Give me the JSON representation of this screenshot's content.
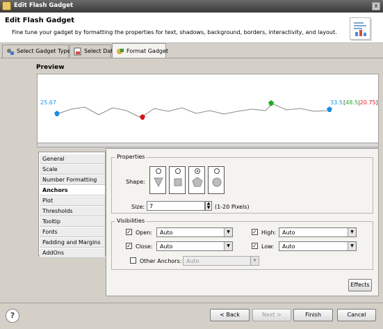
{
  "window": {
    "title": "Edit Flash Gadget",
    "close_glyph": "x"
  },
  "header": {
    "title": "Edit Flash Gadget",
    "subtitle": "Fine tune your gadget by formatting the properties for text, shadows, background, borders, interactivity, and layout."
  },
  "tabs": [
    {
      "label": "Select Gadget Type",
      "icon": "gadget-type-icon"
    },
    {
      "label": "Select Data",
      "icon": "data-icon"
    },
    {
      "label": "Format Gadget",
      "icon": "format-icon",
      "active": true
    }
  ],
  "preview": {
    "label": "Preview",
    "open_value": "25.67",
    "close_value": "33.5",
    "high_value": "48.5",
    "low_value": "20.75",
    "open_color": "#1a8fe0",
    "close_color": "#1a8fe0",
    "high_color": "#22aa22",
    "low_color": "#dd1111"
  },
  "sidebar": {
    "items": [
      "General",
      "Scale",
      "Number Formatting",
      "Anchors",
      "Plot",
      "Thresholds",
      "Tooltip",
      "Fonts",
      "Padding and Margins",
      "AddOns"
    ],
    "active": "Anchors"
  },
  "properties": {
    "legend": "Properties",
    "shape_label": "Shape:",
    "shapes": [
      "triangle",
      "square",
      "pentagon",
      "circle"
    ],
    "selected_shape": "pentagon",
    "size_label": "Size:",
    "size_value": "7",
    "size_hint": "(1-20 Pixels)"
  },
  "visibilities": {
    "legend": "Visibilities",
    "open_label": "Open:",
    "open_value": "Auto",
    "close_label": "Close:",
    "close_value": "Auto",
    "high_label": "High:",
    "high_value": "Auto",
    "low_label": "Low:",
    "low_value": "Auto",
    "other_label": "Other Anchors:",
    "other_value": "Auto"
  },
  "buttons": {
    "effects": "Effects",
    "back": "< Back",
    "next": "Next >",
    "finish": "Finish",
    "cancel": "Cancel",
    "help": "?"
  }
}
